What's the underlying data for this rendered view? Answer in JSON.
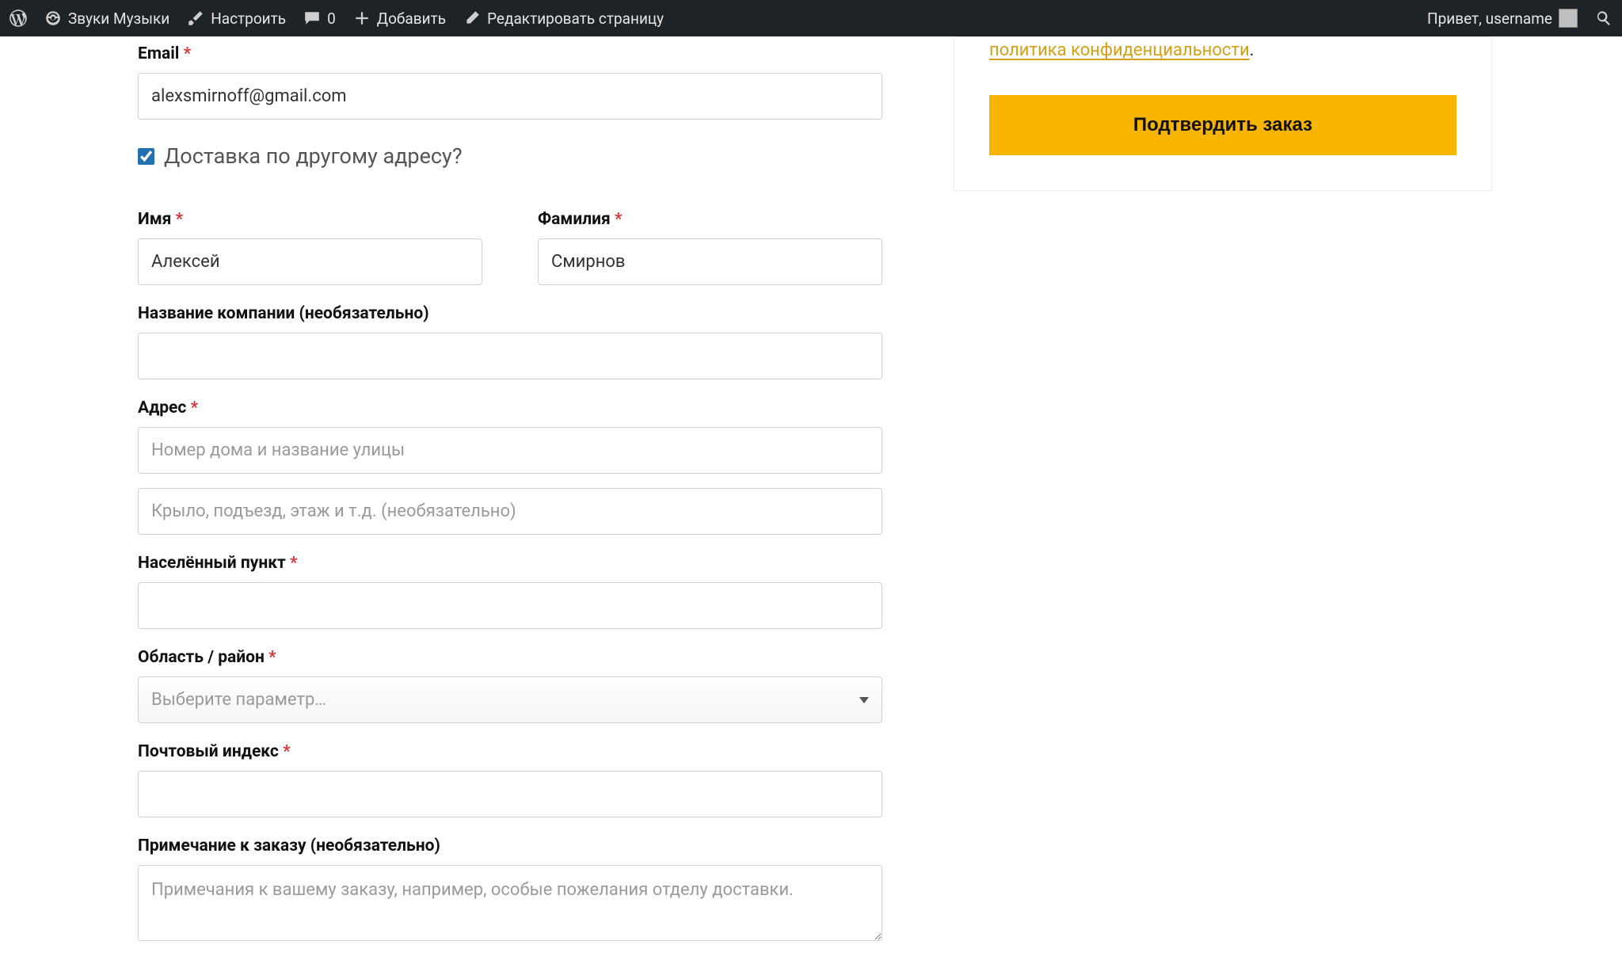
{
  "adminbar": {
    "site_name": "Звуки Музыки",
    "customize": "Настроить",
    "comments_count": "0",
    "add": "Добавить",
    "edit_page": "Редактировать страницу",
    "greeting": "Привет, username"
  },
  "form": {
    "email_label": "Email",
    "email_value": "alexsmirnoff@gmail.com",
    "ship_different_label": "Доставка по другому адресу?",
    "ship_different_checked": true,
    "first_name_label": "Имя",
    "first_name_value": "Алексей",
    "last_name_label": "Фамилия",
    "last_name_value": "Смирнов",
    "company_label": "Название компании (необязательно)",
    "company_value": "",
    "address_label": "Адрес",
    "address1_placeholder": "Номер дома и название улицы",
    "address1_value": "",
    "address2_placeholder": "Крыло, подъезд, этаж и т.д. (необязательно)",
    "address2_value": "",
    "city_label": "Населённый пункт",
    "city_value": "",
    "state_label": "Область / район",
    "state_placeholder": "Выберите параметр…",
    "state_value": "",
    "postcode_label": "Почтовый индекс",
    "postcode_value": "",
    "notes_label": "Примечание к заказу (необязательно)",
    "notes_placeholder": "Примечания к вашему заказу, например, особые пожелания отделу доставки.",
    "notes_value": ""
  },
  "sidebar": {
    "privacy_link": "политика конфиденциальности",
    "submit_label": "Подтвердить заказ"
  }
}
